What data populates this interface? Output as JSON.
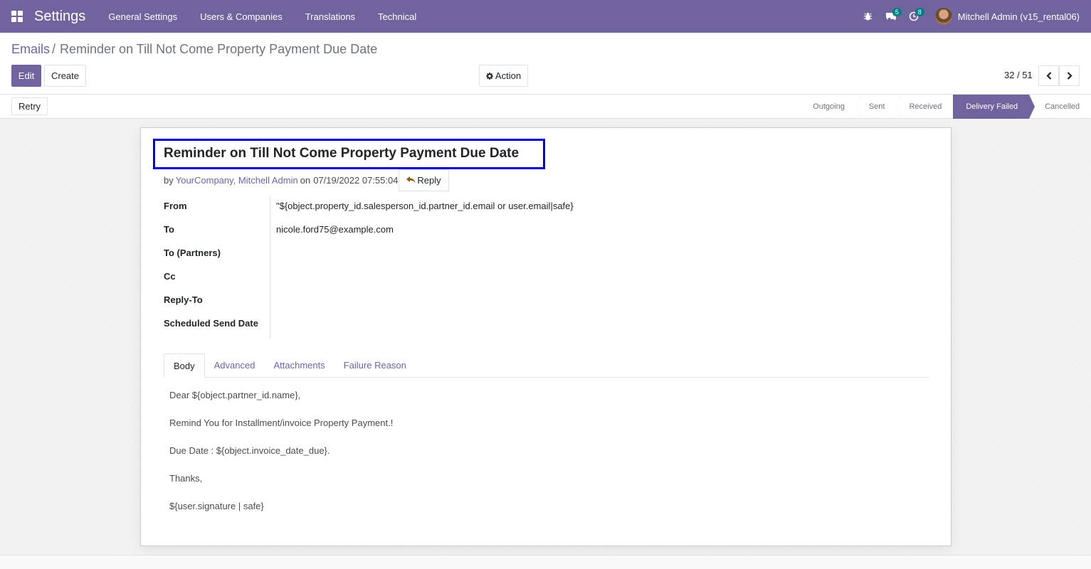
{
  "navbar": {
    "app_title": "Settings",
    "menu": [
      "General Settings",
      "Users & Companies",
      "Translations",
      "Technical"
    ],
    "messages_count": "5",
    "activities_count": "8",
    "user_name": "Mitchell Admin (v15_rental06)"
  },
  "breadcrumb": {
    "parent": "Emails",
    "separator": "/",
    "current": "Reminder on Till Not Come Property Payment Due Date"
  },
  "toolbar": {
    "edit_label": "Edit",
    "create_label": "Create",
    "action_label": "Action",
    "pager_value": "32 / 51"
  },
  "statusbar": {
    "retry_label": "Retry",
    "steps": [
      "Outgoing",
      "Sent",
      "Received",
      "Delivery Failed",
      "Cancelled"
    ],
    "active_step": "Delivery Failed"
  },
  "email": {
    "subject": "Reminder on Till Not Come Property Payment Due Date",
    "by_prefix": "by",
    "author": "YourCompany, Mitchell Admin",
    "on_prefix": "on",
    "date": "07/19/2022 07:55:04",
    "reply_label": "Reply"
  },
  "fields": [
    {
      "label": "From",
      "value": "\"${object.property_id.salesperson_id.partner_id.email or user.email|safe}"
    },
    {
      "label": "To",
      "value": "nicole.ford75@example.com"
    },
    {
      "label": "To (Partners)",
      "value": ""
    },
    {
      "label": "Cc",
      "value": ""
    },
    {
      "label": "Reply-To",
      "value": ""
    },
    {
      "label": "Scheduled Send Date",
      "value": ""
    }
  ],
  "tabs": [
    "Body",
    "Advanced",
    "Attachments",
    "Failure Reason"
  ],
  "active_tab": "Body",
  "body_lines": [
    "Dear ${object.partner_id.name},",
    "Remind You for Installment/invoice Property Payment.!",
    "Due Date : ${object.invoice_date_due}.",
    "Thanks,",
    "${user.signature | safe}"
  ],
  "colors": {
    "brand": "#71639e",
    "highlight_box": "#0000d6",
    "badge": "#017e84"
  }
}
